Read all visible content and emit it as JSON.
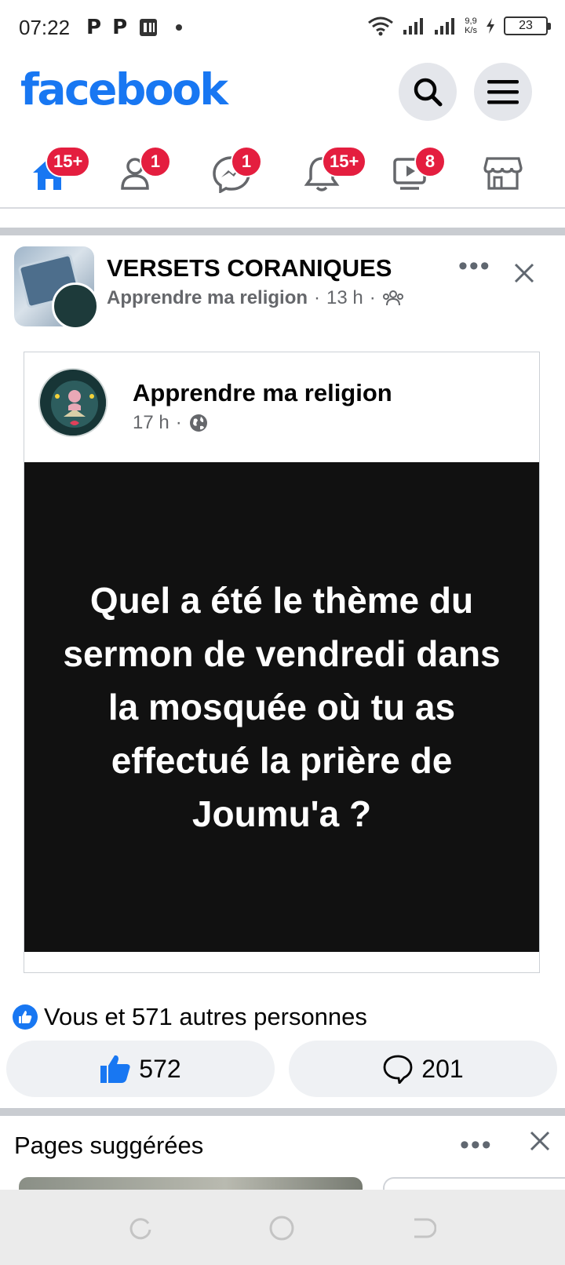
{
  "status_bar": {
    "time": "07:22",
    "icons": [
      "p-notification-icon",
      "p-notification-icon",
      "sim-icon",
      "dot"
    ],
    "net_speed_value": "9,9",
    "net_speed_unit": "K/s",
    "battery": "23"
  },
  "header": {
    "logo": "facebook",
    "search_icon": "search-icon",
    "menu_icon": "hamburger-menu-icon"
  },
  "nav": [
    {
      "name": "home",
      "icon": "home-icon",
      "badge": "15+",
      "active": true
    },
    {
      "name": "friends",
      "icon": "friends-icon",
      "badge": "1"
    },
    {
      "name": "messenger",
      "icon": "messenger-icon",
      "badge": "1"
    },
    {
      "name": "notifications",
      "icon": "bell-icon",
      "badge": "15+"
    },
    {
      "name": "watch",
      "icon": "video-icon",
      "badge": "8"
    },
    {
      "name": "marketplace",
      "icon": "marketplace-icon",
      "badge": ""
    }
  ],
  "post": {
    "group_name": "VERSETS CORANIQUES",
    "author": "Apprendre ma religion",
    "time": "13 h",
    "audience_icon": "group-icon",
    "shared": {
      "author": "Apprendre ma religion",
      "time": "17 h",
      "audience_icon": "globe-icon",
      "text": "Quel a été le thème du sermon de vendredi dans la mosquée où tu as effectué la prière de Joumu'a ?"
    },
    "reactions_summary": "Vous et 571 autres personnes",
    "like_count": "572",
    "comment_count": "201"
  },
  "suggested": {
    "title": "Pages suggérées"
  },
  "colors": {
    "brand": "#1877f2",
    "badge": "#e41e3f",
    "quote_bg": "#111111"
  }
}
